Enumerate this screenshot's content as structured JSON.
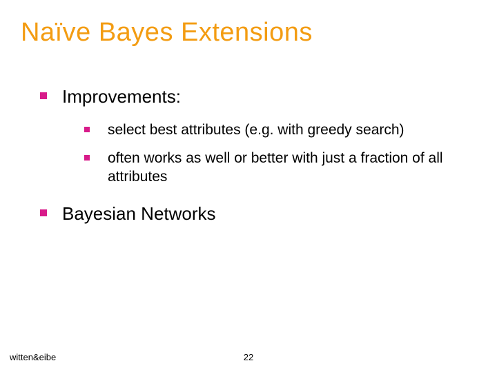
{
  "title": "Naïve Bayes Extensions",
  "items": {
    "l1_0": "Improvements:",
    "l2_0": "select best attributes (e.g. with greedy search)",
    "l2_1": "often works as well or better with just a fraction of all attributes",
    "l1_1": "Bayesian Networks"
  },
  "footer": {
    "left": "witten&eibe",
    "page": "22"
  }
}
